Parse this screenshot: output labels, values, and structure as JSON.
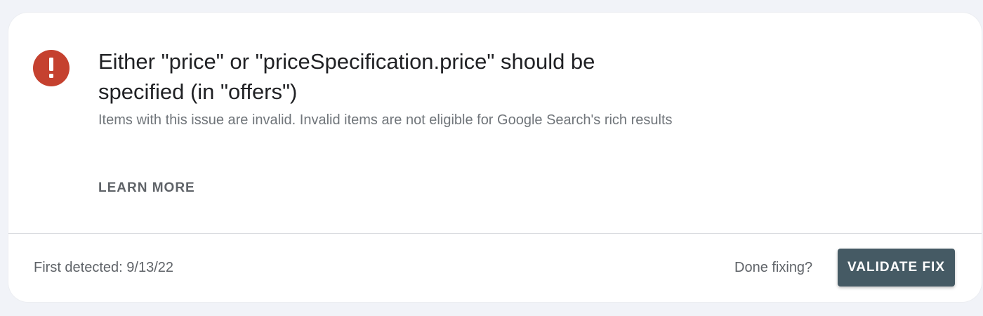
{
  "issue": {
    "icon": "error-exclamation-icon",
    "icon_color": "#c5412f",
    "title": "Either \"price\" or \"priceSpecification.price\" should be specified (in \"offers\")",
    "description": "Items with this issue are invalid. Invalid items are not eligible for Google Search's rich results",
    "learn_more_label": "LEARN MORE"
  },
  "footer": {
    "first_detected": "First detected: 9/13/22",
    "done_fixing": "Done fixing?",
    "validate_fix_label": "VALIDATE FIX",
    "validate_fix_color": "#455a64"
  }
}
